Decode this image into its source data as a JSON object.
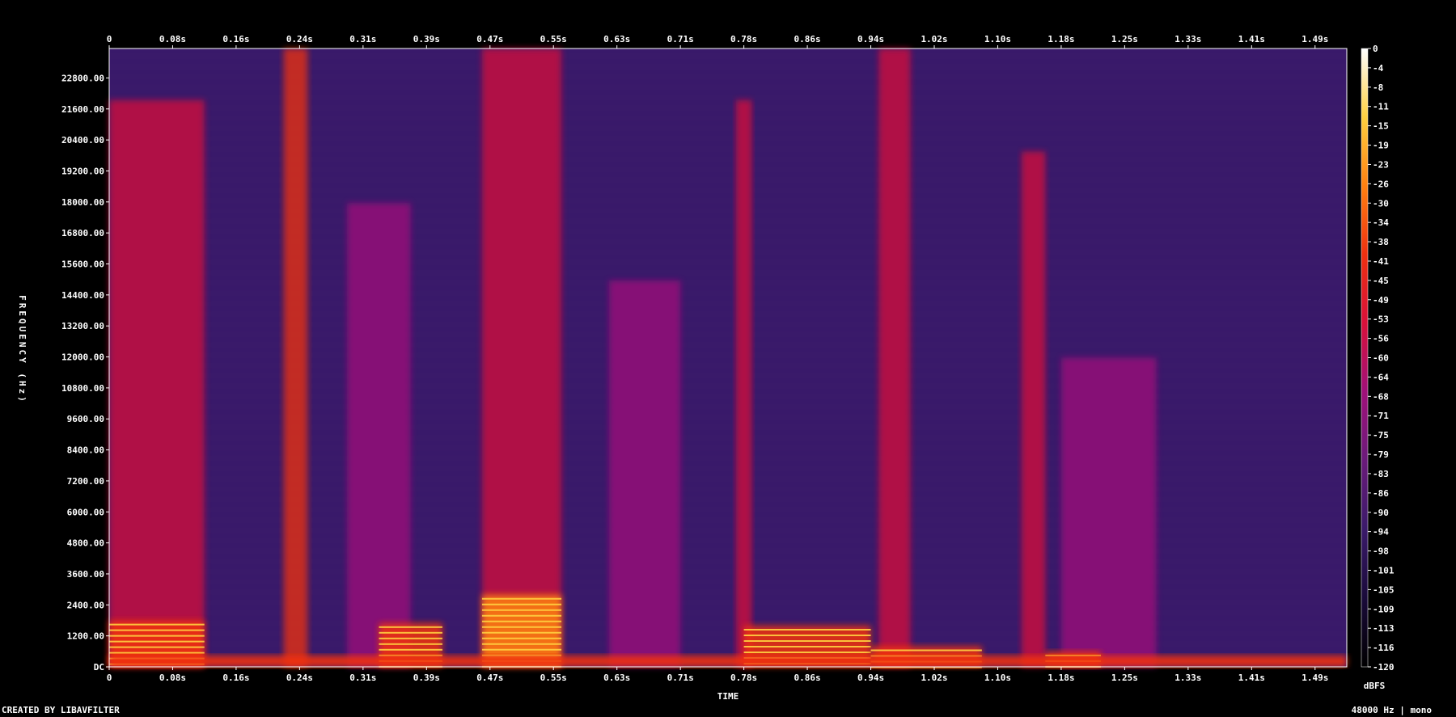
{
  "chart_data": {
    "type": "heatmap",
    "subtype": "spectrogram",
    "xlabel": "TIME",
    "ylabel": "FREQUENCY (Hz)",
    "colorbar_label": "dBFS",
    "x_ticks": [
      "0",
      "0.08s",
      "0.16s",
      "0.24s",
      "0.31s",
      "0.39s",
      "0.47s",
      "0.55s",
      "0.63s",
      "0.71s",
      "0.78s",
      "0.86s",
      "0.94s",
      "1.02s",
      "1.10s",
      "1.18s",
      "1.25s",
      "1.33s",
      "1.41s",
      "1.49s"
    ],
    "y_ticks": [
      "DC",
      "1200.00",
      "2400.00",
      "3600.00",
      "4800.00",
      "6000.00",
      "7200.00",
      "8400.00",
      "9600.00",
      "10800.00",
      "12000.00",
      "13200.00",
      "14400.00",
      "15600.00",
      "16800.00",
      "18000.00",
      "19200.00",
      "20400.00",
      "21600.00",
      "22800.00"
    ],
    "color_ticks": [
      "0",
      "-4",
      "-8",
      "-11",
      "-15",
      "-19",
      "-23",
      "-26",
      "-30",
      "-34",
      "-38",
      "-41",
      "-45",
      "-49",
      "-53",
      "-56",
      "-60",
      "-64",
      "-68",
      "-71",
      "-75",
      "-79",
      "-83",
      "-86",
      "-90",
      "-94",
      "-98",
      "-101",
      "-105",
      "-109",
      "-113",
      "-116",
      "-120"
    ],
    "xlim": [
      0,
      1.56
    ],
    "ylim": [
      0,
      24000
    ],
    "zlim": [
      -120,
      0
    ],
    "colormap": [
      "#000000",
      "#1a0a3a",
      "#3a1a6a",
      "#6a1a7a",
      "#a0107a",
      "#d8103a",
      "#f03010",
      "#ff8010",
      "#ffd040",
      "#ffffff"
    ],
    "background_level_db": -90,
    "events": [
      {
        "t_start": 0.0,
        "t_end": 0.12,
        "f_max": 22000,
        "level_db": -55
      },
      {
        "t_start": 0.22,
        "t_end": 0.25,
        "f_max": 24000,
        "level_db": -45
      },
      {
        "t_start": 0.3,
        "t_end": 0.38,
        "f_max": 18000,
        "level_db": -62
      },
      {
        "t_start": 0.47,
        "t_end": 0.57,
        "f_max": 24000,
        "level_db": -52
      },
      {
        "t_start": 0.63,
        "t_end": 0.72,
        "f_max": 15000,
        "level_db": -65
      },
      {
        "t_start": 0.79,
        "t_end": 0.81,
        "f_max": 22000,
        "level_db": -58
      },
      {
        "t_start": 0.97,
        "t_end": 1.01,
        "f_max": 24000,
        "level_db": -55
      },
      {
        "t_start": 1.15,
        "t_end": 1.18,
        "f_max": 20000,
        "level_db": -55
      },
      {
        "t_start": 1.2,
        "t_end": 1.32,
        "f_max": 12000,
        "level_db": -68
      }
    ],
    "harmonic_bands": [
      {
        "t_start": 0.0,
        "t_end": 0.12,
        "f_min": 0,
        "f_max": 1800,
        "level_db": -10
      },
      {
        "t_start": 0.34,
        "t_end": 0.42,
        "f_min": 0,
        "f_max": 1700,
        "level_db": -12
      },
      {
        "t_start": 0.47,
        "t_end": 0.57,
        "f_min": 0,
        "f_max": 2800,
        "level_db": -8
      },
      {
        "t_start": 0.8,
        "t_end": 0.96,
        "f_min": 0,
        "f_max": 1600,
        "level_db": -20
      },
      {
        "t_start": 0.96,
        "t_end": 1.1,
        "f_min": 0,
        "f_max": 800,
        "level_db": -15
      },
      {
        "t_start": 1.18,
        "t_end": 1.25,
        "f_min": 0,
        "f_max": 600,
        "level_db": -18
      }
    ]
  },
  "footer": {
    "left": "CREATED BY LIBAVFILTER",
    "right": "48000 Hz | mono"
  }
}
